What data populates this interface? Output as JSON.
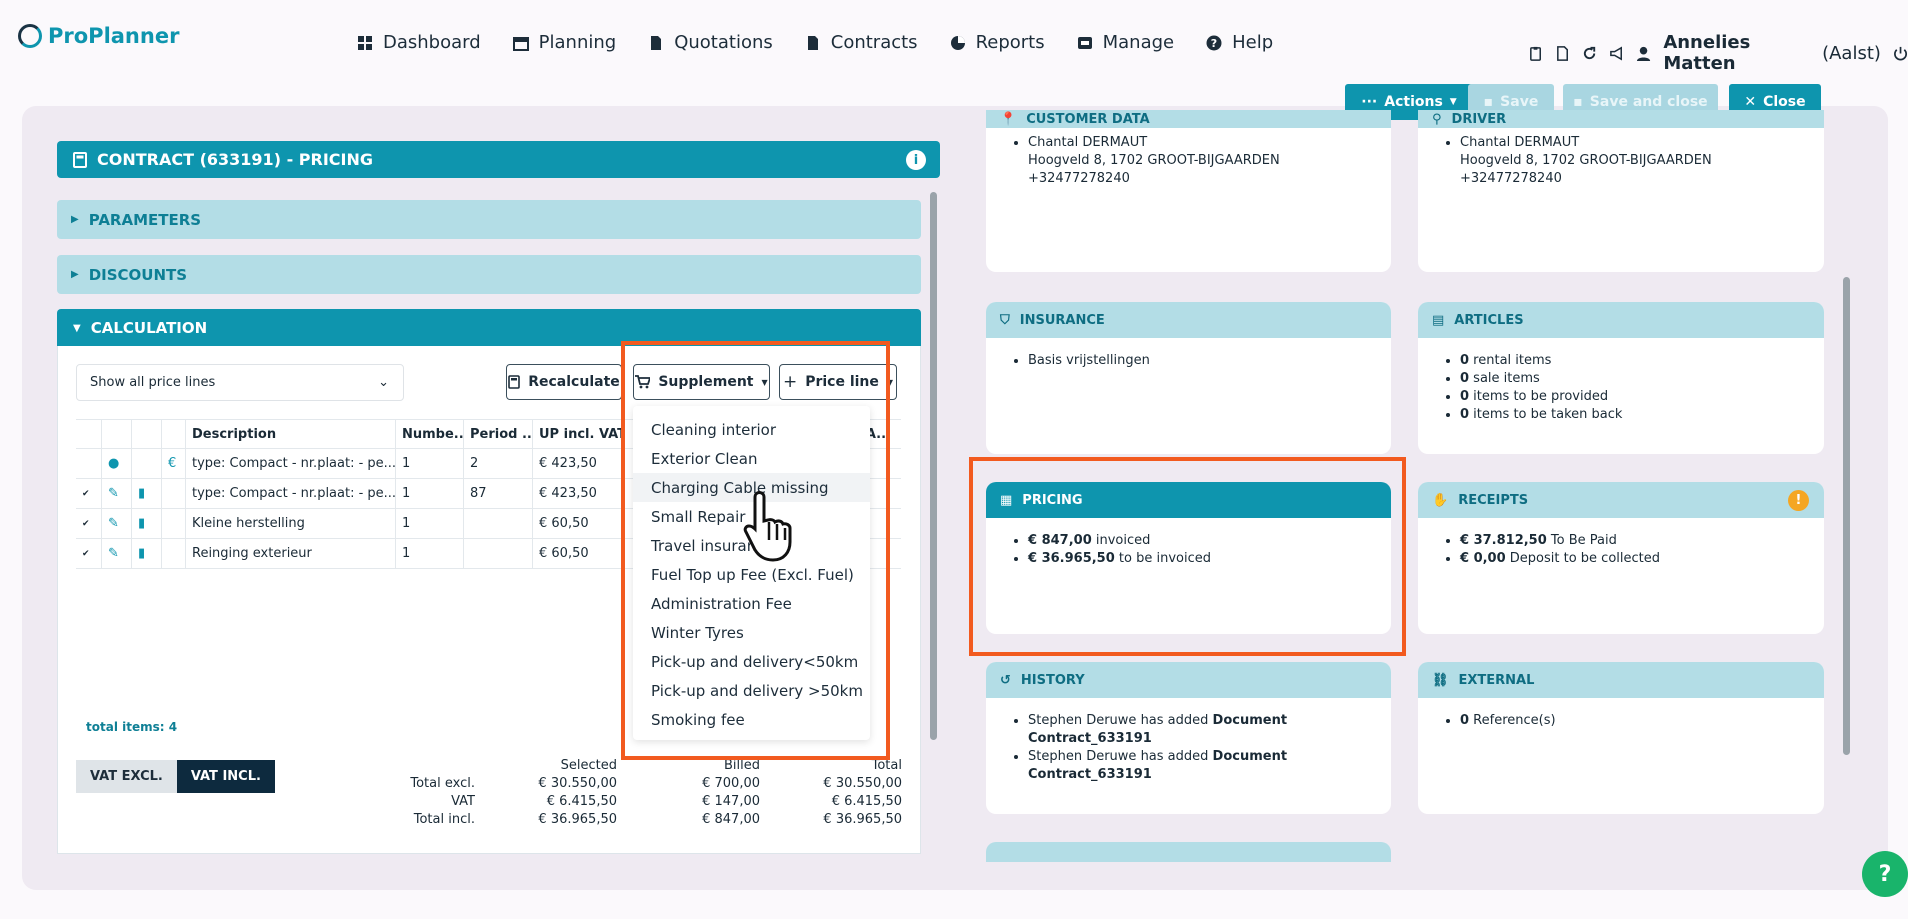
{
  "app": {
    "name": "ProPlanner"
  },
  "nav": {
    "items": [
      "Dashboard",
      "Planning",
      "Quotations",
      "Contracts",
      "Reports",
      "Manage",
      "Help"
    ]
  },
  "user": {
    "name": "Annelies Matten",
    "location": "(Aalst)"
  },
  "toolbar": {
    "actions": "Actions",
    "save": "Save",
    "save_close": "Save and close",
    "close": "Close"
  },
  "contract": {
    "title": "CONTRACT (633191) - PRICING"
  },
  "sections": {
    "parameters": "PARAMETERS",
    "discounts": "DISCOUNTS",
    "calculation": "CALCULATION"
  },
  "calc": {
    "filter": "Show all price lines",
    "recalculate": "Recalculate",
    "supplement": "Supplement",
    "price_line": "Price line",
    "columns": [
      "Description",
      "Numbe...",
      "Period ...",
      "UP incl. VAT..."
    ],
    "col_extra": "A...",
    "rows": [
      {
        "description": "type: Compact - nr.plaat: - pe...",
        "number": "1",
        "period": "2",
        "up": "€ 423,50"
      },
      {
        "description": "type: Compact - nr.plaat: - pe...",
        "number": "1",
        "period": "87",
        "up": "€ 423,50"
      },
      {
        "description": "Kleine herstelling",
        "number": "1",
        "period": "",
        "up": "€ 60,50"
      },
      {
        "description": "Reinging exterieur",
        "number": "1",
        "period": "",
        "up": "€ 60,50"
      }
    ],
    "total_items": "total items: 4",
    "vat_excl": "VAT EXCL.",
    "vat_incl": "VAT INCL.",
    "totals_headers": [
      "Selected",
      "Billed",
      "Total"
    ],
    "totals": [
      {
        "label": "Total excl.",
        "selected": "€ 30.550,00",
        "billed": "€ 700,00",
        "total": "€ 30.550,00"
      },
      {
        "label": "VAT",
        "selected": "€ 6.415,50",
        "billed": "€ 147,00",
        "total": "€ 6.415,50"
      },
      {
        "label": "Total incl.",
        "selected": "€ 36.965,50",
        "billed": "€ 847,00",
        "total": "€ 36.965,50"
      }
    ]
  },
  "supplement_menu": [
    "Cleaning interior",
    "Exterior Clean",
    "Charging Cable missing",
    "Small Repair",
    "Travel insurance",
    "Fuel Top up Fee (Excl. Fuel)",
    "Administration Fee",
    "Winter Tyres",
    "Pick-up and delivery<50km",
    "Pick-up and delivery >50km",
    "Smoking fee"
  ],
  "cards": {
    "customer": {
      "title": "CUSTOMER DATA",
      "name": "Chantal DERMAUT",
      "address": "Hoogveld 8, 1702 GROOT-BIJGAARDEN",
      "phone": "+32477278240"
    },
    "driver": {
      "title": "DRIVER",
      "name": "Chantal DERMAUT",
      "address": "Hoogveld 8, 1702 GROOT-BIJGAARDEN",
      "phone": "+32477278240"
    },
    "insurance": {
      "title": "INSURANCE",
      "items": [
        "Basis vrijstellingen"
      ]
    },
    "articles": {
      "title": "ARTICLES",
      "items": [
        {
          "b": "0",
          "t": " rental items"
        },
        {
          "b": "0",
          "t": " sale items"
        },
        {
          "b": "0",
          "t": " items to be provided"
        },
        {
          "b": "0",
          "t": " items to be taken back"
        }
      ]
    },
    "pricing": {
      "title": "PRICING",
      "items": [
        {
          "b": "€ 847,00",
          "t": " invoiced"
        },
        {
          "b": "€ 36.965,50",
          "t": " to be invoiced"
        }
      ]
    },
    "receipts": {
      "title": "RECEIPTS",
      "items": [
        {
          "b": "€ 37.812,50",
          "t": " To Be Paid"
        },
        {
          "b": "€ 0,00",
          "t": " Deposit to be collected"
        }
      ]
    },
    "history": {
      "title": "HISTORY",
      "items": [
        {
          "pre": "Stephen Deruwe has added ",
          "b": "Document Contract_633191"
        },
        {
          "pre": "Stephen Deruwe has added ",
          "b": "Document Contract_633191"
        }
      ]
    },
    "external": {
      "title": "EXTERNAL",
      "items": [
        {
          "b": "0",
          "t": " Reference(s)"
        }
      ]
    }
  },
  "colors": {
    "accent": "#0e95ae",
    "highlight": "#f25a1f",
    "light": "#b3dde6"
  }
}
